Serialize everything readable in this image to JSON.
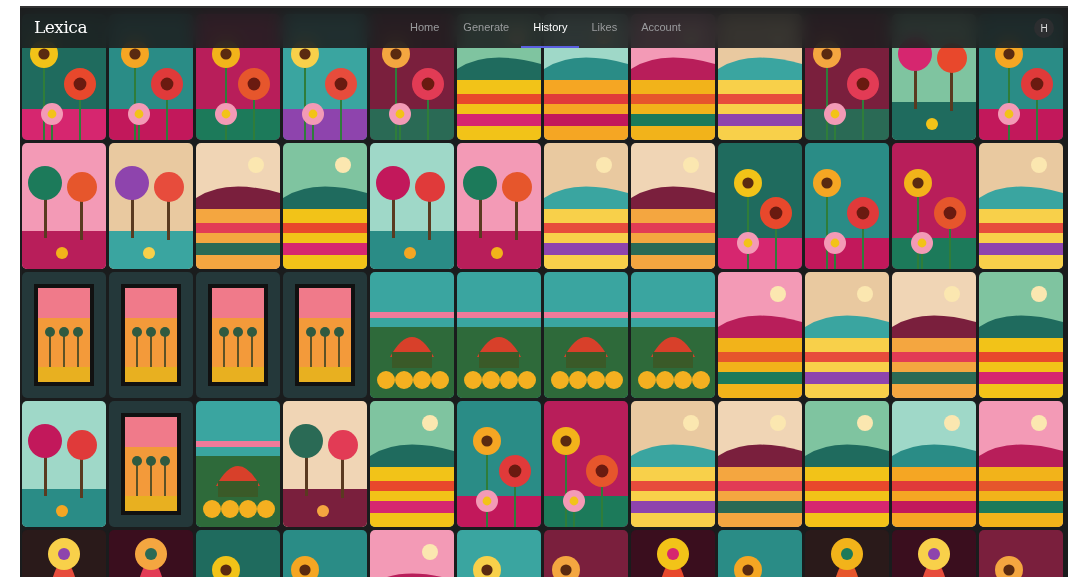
{
  "navbar": {
    "logo": "Lexica",
    "links": [
      {
        "label": "Home",
        "selected": false
      },
      {
        "label": "Generate",
        "selected": false
      },
      {
        "label": "History",
        "selected": true
      },
      {
        "label": "Likes",
        "selected": false
      },
      {
        "label": "Account",
        "selected": false
      }
    ],
    "avatar": "H"
  }
}
